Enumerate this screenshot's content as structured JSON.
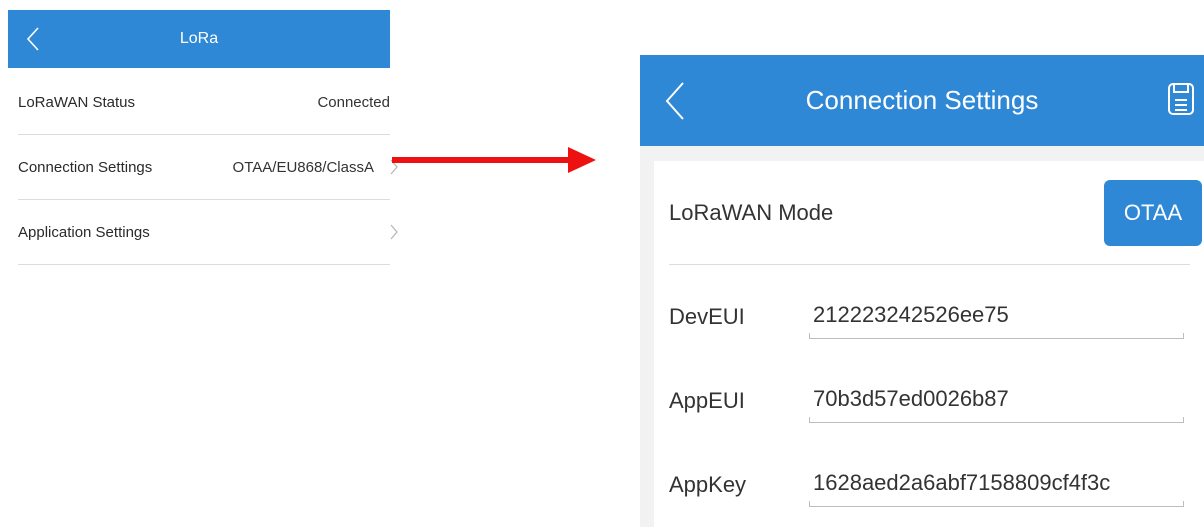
{
  "colors": {
    "accent": "#2e88d6",
    "arrow": "#ee1111",
    "divider": "#dcdcdc"
  },
  "left_screen": {
    "title": "LoRa",
    "rows": [
      {
        "label": "LoRaWAN Status",
        "value": "Connected"
      },
      {
        "label": "Connection Settings",
        "value": "OTAA/EU868/ClassA"
      },
      {
        "label": "Application Settings",
        "value": ""
      }
    ]
  },
  "right_screen": {
    "title": "Connection Settings",
    "mode": {
      "label": "LoRaWAN Mode",
      "value": "OTAA"
    },
    "fields": [
      {
        "label": "DevEUI",
        "value": "212223242526ee75"
      },
      {
        "label": "AppEUI",
        "value": "70b3d57ed0026b87"
      },
      {
        "label": "AppKey",
        "value": "1628aed2a6abf7158809cf4f3c"
      }
    ]
  },
  "icons": {
    "back": "chevron-left-icon",
    "chevron": "chevron-right-icon",
    "save": "save-icon",
    "arrow": "arrow-right-icon"
  }
}
